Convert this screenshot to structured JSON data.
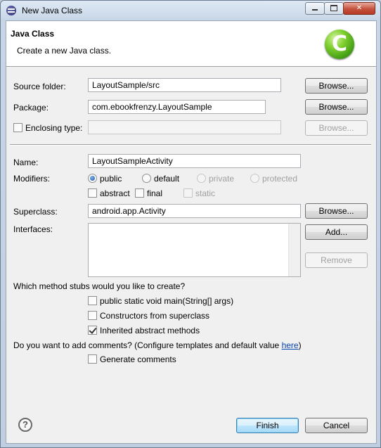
{
  "window": {
    "title": "New Java Class"
  },
  "header": {
    "title": "Java Class",
    "description": "Create a new Java class."
  },
  "source_folder": {
    "label": "Source folder:",
    "value": "LayoutSample/src",
    "button": "Browse..."
  },
  "package": {
    "label": "Package:",
    "value": "com.ebookfrenzy.LayoutSample",
    "button": "Browse..."
  },
  "enclosing": {
    "label": "Enclosing type:",
    "value": "",
    "button": "Browse..."
  },
  "name": {
    "label": "Name:",
    "value": "LayoutSampleActivity"
  },
  "modifiers": {
    "label": "Modifiers:",
    "public": "public",
    "default": "default",
    "private": "private",
    "protected": "protected",
    "abstract": "abstract",
    "final": "final",
    "static": "static"
  },
  "superclass": {
    "label": "Superclass:",
    "value": "android.app.Activity",
    "button": "Browse..."
  },
  "interfaces": {
    "label": "Interfaces:",
    "add_button": "Add...",
    "remove_button": "Remove"
  },
  "stubs": {
    "question": "Which method stubs would you like to create?",
    "main": "public static void main(String[] args)",
    "constructors": "Constructors from superclass",
    "inherited": "Inherited abstract methods"
  },
  "comments": {
    "question_prefix": "Do you want to add comments? (Configure templates and default value ",
    "link": "here",
    "question_suffix": ")",
    "generate": "Generate comments"
  },
  "footer": {
    "help": "?",
    "finish": "Finish",
    "cancel": "Cancel"
  }
}
